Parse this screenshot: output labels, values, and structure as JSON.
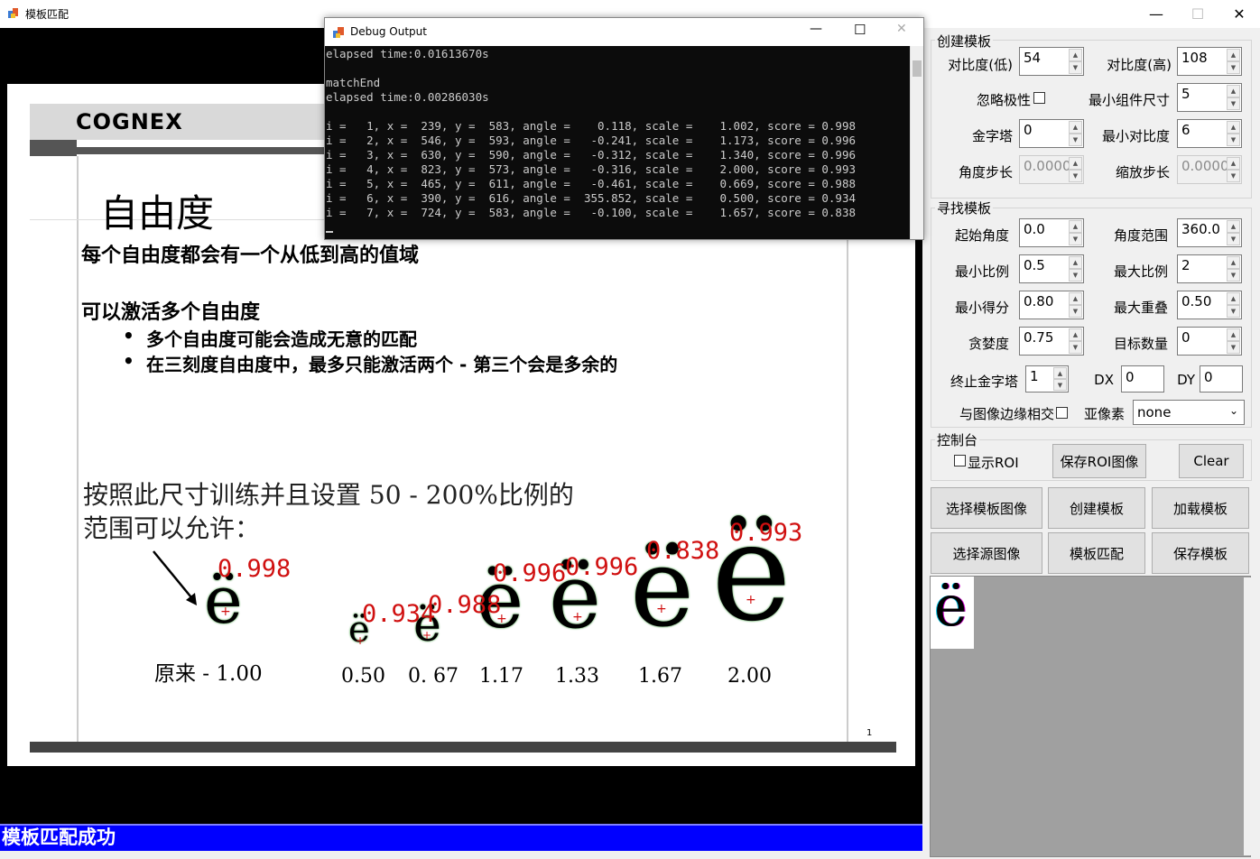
{
  "window": {
    "title": "模板匹配",
    "minimize_glyph": "—",
    "maximize_glyph": "☐",
    "close_glyph": "✕"
  },
  "slide": {
    "logo": "COGNEX",
    "heading": "自由度",
    "line1": "每个自由度都会有一个从低到高的值域",
    "line2": "可以激活多个自由度",
    "bullet1": "多个自由度可能会造成无意的匹配",
    "bullet2": "在三刻度自由度中，最多只能激活两个 - 第三个会是多余的",
    "train_text_1": "按照此尺寸训练并且设置 50 - 200%比例的",
    "train_text_2": "范围可以允许：",
    "original_label": "原来 - 1.00",
    "scale_labels": [
      "0.50",
      "0. 67",
      "1.17",
      "1.33",
      "1.67",
      "2.00"
    ],
    "glyph": "ë",
    "page_number": "1",
    "scores": [
      "0.998",
      "0.934",
      "0.988",
      "0.996",
      "0.996",
      "0.838",
      "0.993"
    ]
  },
  "debug": {
    "title": "Debug Output",
    "lines": [
      "elapsed time:0.01613670s",
      "",
      "matchEnd",
      "elapsed time:0.00286030s",
      "",
      "i =   1, x =  239, y =  583, angle =    0.118, scale =    1.002, score = 0.998",
      "i =   2, x =  546, y =  593, angle =   -0.241, scale =    1.173, score = 0.996",
      "i =   3, x =  630, y =  590, angle =   -0.312, scale =    1.340, score = 0.996",
      "i =   4, x =  823, y =  573, angle =   -0.316, scale =    2.000, score = 0.993",
      "i =   5, x =  465, y =  611, angle =   -0.461, scale =    0.669, score = 0.988",
      "i =   6, x =  390, y =  616, angle =  355.852, scale =    0.500, score = 0.934",
      "i =   7, x =  724, y =  583, angle =   -0.100, scale =    1.657, score = 0.838"
    ]
  },
  "create": {
    "title": "创建模板",
    "contrast_low_label": "对比度(低)",
    "contrast_low": "54",
    "contrast_high_label": "对比度(高)",
    "contrast_high": "108",
    "ignore_polarity_label": "忽略极性",
    "min_component_label": "最小组件尺寸",
    "min_component": "5",
    "pyramid_label": "金字塔",
    "pyramid": "0",
    "min_contrast_label": "最小对比度",
    "min_contrast": "6",
    "angle_step_label": "角度步长",
    "angle_step": "0.0000",
    "scale_step_label": "缩放步长",
    "scale_step": "0.0000"
  },
  "find": {
    "title": "寻找模板",
    "start_angle_label": "起始角度",
    "start_angle": "0.0",
    "angle_range_label": "角度范围",
    "angle_range": "360.0",
    "min_scale_label": "最小比例",
    "min_scale": "0.5",
    "max_scale_label": "最大比例",
    "max_scale": "2",
    "min_score_label": "最小得分",
    "min_score": "0.80",
    "max_overlap_label": "最大重叠",
    "max_overlap": "0.50",
    "greediness_label": "贪婪度",
    "greediness": "0.75",
    "target_count_label": "目标数量",
    "target_count": "0",
    "stop_pyramid_label": "终止金字塔",
    "stop_pyramid": "1",
    "dx_label": "DX",
    "dx": "0",
    "dy_label": "DY",
    "dy": "0",
    "border_intersect_label": "与图像边缘相交",
    "subpixel_label": "亚像素",
    "subpixel": "none"
  },
  "console": {
    "title": "控制台",
    "show_roi_label": "显示ROI",
    "save_roi_label": "保存ROI图像",
    "clear_label": "Clear"
  },
  "actions": {
    "select_template_image": "选择模板图像",
    "create_template": "创建模板",
    "load_template": "加载模板",
    "select_source_image": "选择源图像",
    "template_match": "模板匹配",
    "save_template": "保存模板"
  },
  "status": "模板匹配成功",
  "colors": {
    "status_bar": "#0000ff",
    "score_text": "#d01010",
    "console_bg": "#0c0c0c"
  }
}
